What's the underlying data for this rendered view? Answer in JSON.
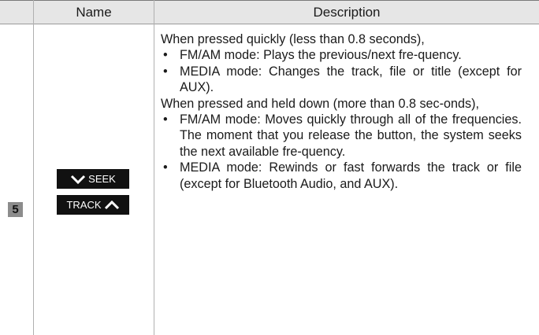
{
  "header": {
    "name": "Name",
    "description": "Description"
  },
  "row": {
    "number": "5",
    "seek_label": "SEEK",
    "track_label": "TRACK",
    "icons": {
      "seek": "chevron-down-icon",
      "track": "chevron-up-icon"
    },
    "desc": {
      "intro1": "When pressed quickly (less than 0.8 seconds),",
      "b1": "FM/AM mode: Plays the previous/next fre-quency.",
      "b2": "MEDIA mode: Changes the track, file or title (except for AUX).",
      "intro2": "When pressed and held down (more than 0.8 sec-onds),",
      "b3": "FM/AM mode: Moves quickly through all of the frequencies. The moment that you release the button, the system seeks the next available fre-quency.",
      "b4": "MEDIA mode: Rewinds or fast forwards the track or file (except for Bluetooth Audio, and AUX)."
    }
  },
  "bullet": "•"
}
